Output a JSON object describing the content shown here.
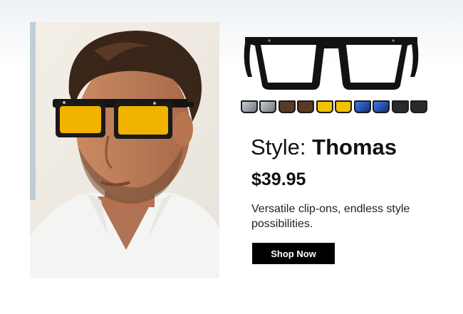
{
  "product": {
    "style_label": "Style:",
    "style_name": "Thomas",
    "price": "$39.95",
    "description": "Versatile clip-ons, endless style possibilities.",
    "cta_label": "Shop Now"
  },
  "clip_on_lenses": [
    {
      "name": "gray-mirror",
      "color": "#8e959b"
    },
    {
      "name": "brown",
      "color": "#5a3a22"
    },
    {
      "name": "yellow",
      "color": "#f2c200"
    },
    {
      "name": "blue-mirror",
      "color": "#1d4fb8"
    },
    {
      "name": "black",
      "color": "#2a2a2a"
    }
  ],
  "images": {
    "model_photo": "man-wearing-yellow-lens-glasses",
    "frame_photo": "black-rectangular-frames"
  },
  "colors": {
    "accent": "#000000",
    "text": "#111111",
    "lens_yellow": "#f2b200"
  }
}
